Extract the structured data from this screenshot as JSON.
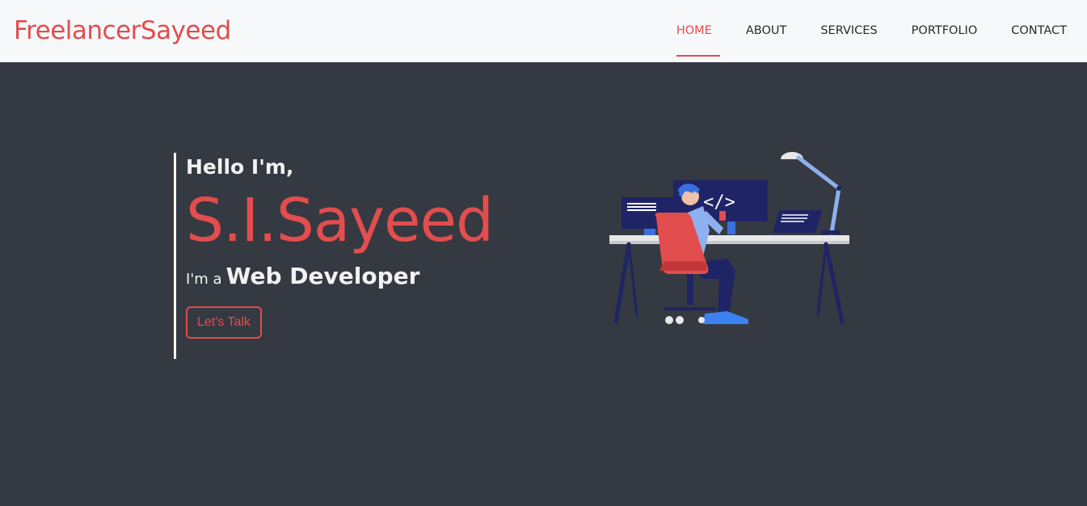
{
  "brand": {
    "name": "FreelancerSayeed"
  },
  "nav": {
    "items": [
      {
        "label": "HOME",
        "active": true
      },
      {
        "label": "ABOUT",
        "active": false
      },
      {
        "label": "SERVICES",
        "active": false
      },
      {
        "label": "PORTFOLIO",
        "active": false
      },
      {
        "label": "CONTACT",
        "active": false
      }
    ]
  },
  "hero": {
    "greeting": "Hello I'm,",
    "name": "S.I.Sayeed",
    "role_prefix": "I'm a",
    "role_title": "Web Developer",
    "cta_label": "Let's Talk"
  },
  "illustration": {
    "icon": "developer-at-desk-illustration",
    "code_symbol": "</>"
  },
  "colors": {
    "accent": "#e24d4d",
    "background": "#353941",
    "navbar": "#f7f8fa",
    "text_light": "#f2f2f2",
    "monitor": "#1f2466",
    "lamp": "#8fb0ee"
  }
}
